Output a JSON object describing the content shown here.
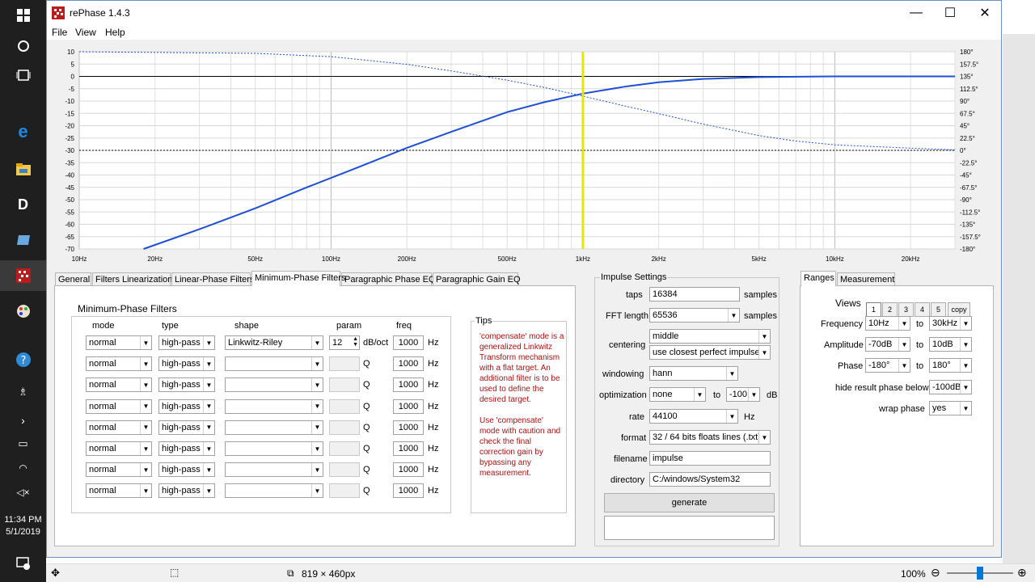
{
  "app": {
    "title": "rePhase 1.4.3"
  },
  "menu": [
    "File",
    "View",
    "Help"
  ],
  "window_controls": {
    "minimize": "—",
    "maximize": "☐",
    "close": "✕"
  },
  "taskbar": {
    "time": "11:34 PM",
    "date": "5/1/2019"
  },
  "chart_data": {
    "type": "line",
    "x_scale": "log",
    "xlim": [
      10,
      30000
    ],
    "x_ticks": [
      "10Hz",
      "20Hz",
      "50Hz",
      "100Hz",
      "200Hz",
      "500Hz",
      "1kHz",
      "2kHz",
      "5kHz",
      "10kHz",
      "20kHz"
    ],
    "x_tick_values": [
      10,
      20,
      50,
      100,
      200,
      500,
      1000,
      2000,
      5000,
      10000,
      20000
    ],
    "ylim": [
      -70,
      10
    ],
    "y_ticks": [
      "10",
      "5",
      "0",
      "-5",
      "-10",
      "-15",
      "-20",
      "-25",
      "-30",
      "-35",
      "-40",
      "-45",
      "-50",
      "-55",
      "-60",
      "-65",
      "-70"
    ],
    "y_tick_values": [
      10,
      5,
      0,
      -5,
      -10,
      -15,
      -20,
      -25,
      -30,
      -35,
      -40,
      -45,
      -50,
      -55,
      -60,
      -65,
      -70
    ],
    "y2lim": [
      -180,
      180
    ],
    "y2_ticks": [
      "180°",
      "157.5°",
      "135°",
      "112.5°",
      "90°",
      "67.5°",
      "45°",
      "22.5°",
      "0°",
      "-22.5°",
      "-45°",
      "-67.5°",
      "-90°",
      "-112.5°",
      "-135°",
      "-157.5°",
      "-180°"
    ],
    "y2_tick_values": [
      180,
      157.5,
      135,
      112.5,
      90,
      67.5,
      45,
      22.5,
      0,
      -22.5,
      -45,
      -67.5,
      -90,
      -112.5,
      -135,
      -157.5,
      -180
    ],
    "grid": true,
    "marker_frequency": 1000,
    "series": [
      {
        "kind": "amplitude",
        "axis": "left",
        "style": "solid",
        "x": [
          18,
          30,
          50,
          80,
          120,
          200,
          300,
          500,
          700,
          1000,
          1500,
          2000,
          3000,
          5000,
          10000,
          30000
        ],
        "y": [
          -70,
          -62,
          -53.5,
          -45,
          -38,
          -29,
          -22.5,
          -14.5,
          -10.5,
          -7,
          -4,
          -2.4,
          -1,
          -0.3,
          0,
          0
        ]
      },
      {
        "kind": "phase",
        "axis": "right",
        "style": "dotted",
        "x": [
          10,
          50,
          100,
          200,
          300,
          500,
          700,
          1000,
          1500,
          2000,
          3000,
          5000,
          7000,
          10000,
          20000,
          30000
        ],
        "y": [
          180,
          177,
          171,
          157,
          145,
          128,
          115,
          99,
          80,
          67,
          48,
          27,
          17,
          10,
          4,
          1
        ]
      }
    ]
  },
  "tabs_left": [
    "General",
    "Filters Linearization",
    "Linear-Phase Filters",
    "Minimum-Phase Filters",
    "Paragraphic Phase EQ",
    "Paragraphic Gain EQ"
  ],
  "filters": {
    "group_title": "Minimum-Phase Filters",
    "headers": {
      "mode": "mode",
      "type": "type",
      "shape": "shape",
      "param": "param",
      "freq": "freq"
    },
    "rows": [
      {
        "mode": "normal",
        "type": "high-pass",
        "shape": "Linkwitz-Riley",
        "param": "12",
        "param_unit": "dB/oct",
        "freq": "1000",
        "freq_unit": "Hz"
      },
      {
        "mode": "normal",
        "type": "high-pass",
        "shape": "",
        "param": "",
        "param_unit": "Q",
        "freq": "1000",
        "freq_unit": "Hz"
      },
      {
        "mode": "normal",
        "type": "high-pass",
        "shape": "",
        "param": "",
        "param_unit": "Q",
        "freq": "1000",
        "freq_unit": "Hz"
      },
      {
        "mode": "normal",
        "type": "high-pass",
        "shape": "",
        "param": "",
        "param_unit": "Q",
        "freq": "1000",
        "freq_unit": "Hz"
      },
      {
        "mode": "normal",
        "type": "high-pass",
        "shape": "",
        "param": "",
        "param_unit": "Q",
        "freq": "1000",
        "freq_unit": "Hz"
      },
      {
        "mode": "normal",
        "type": "high-pass",
        "shape": "",
        "param": "",
        "param_unit": "Q",
        "freq": "1000",
        "freq_unit": "Hz"
      },
      {
        "mode": "normal",
        "type": "high-pass",
        "shape": "",
        "param": "",
        "param_unit": "Q",
        "freq": "1000",
        "freq_unit": "Hz"
      },
      {
        "mode": "normal",
        "type": "high-pass",
        "shape": "",
        "param": "",
        "param_unit": "Q",
        "freq": "1000",
        "freq_unit": "Hz"
      }
    ]
  },
  "tips": {
    "title": "Tips",
    "text": "'compensate' mode is a generalized Linkwitz Transform mechanism with a flat target. An additional filter is to be used to define the desired target.\n\nUse 'compensate' mode with caution and check the final correction gain by bypassing any measurement."
  },
  "impulse": {
    "title": "Impulse Settings",
    "taps_label": "taps",
    "taps": "16384",
    "taps_unit": "samples",
    "fft_label": "FFT length",
    "fft": "65536",
    "fft_unit": "samples",
    "centering_label": "centering",
    "centering": "middle",
    "centering2": "use closest perfect impulse",
    "windowing_label": "windowing",
    "windowing": "hann",
    "optimization_label": "optimization",
    "optimization": "none",
    "opt_to": "to",
    "opt_db": "-100",
    "opt_unit": "dB",
    "rate_label": "rate",
    "rate": "44100",
    "rate_unit": "Hz",
    "format_label": "format",
    "format": "32 / 64 bits floats lines (.txt)",
    "filename_label": "filename",
    "filename": "impulse",
    "directory_label": "directory",
    "directory": "C:/windows/System32",
    "generate": "generate"
  },
  "tabs_right": [
    "Ranges",
    "Measurement"
  ],
  "ranges": {
    "views_label": "Views",
    "views": [
      "1",
      "2",
      "3",
      "4",
      "5",
      "copy"
    ],
    "frequency_label": "Frequency",
    "freq_from": "10Hz",
    "freq_to": "30kHz",
    "amplitude_label": "Amplitude",
    "amp_from": "-70dB",
    "amp_to": "10dB",
    "phase_label": "Phase",
    "phase_from": "-180°",
    "phase_to": "180°",
    "to": "to",
    "hide_label": "hide result phase below",
    "hide_val": "-100dB",
    "wrap_label": "wrap phase",
    "wrap_val": "yes"
  },
  "status": {
    "dimensions": "819 × 460px",
    "zoom": "100%"
  }
}
